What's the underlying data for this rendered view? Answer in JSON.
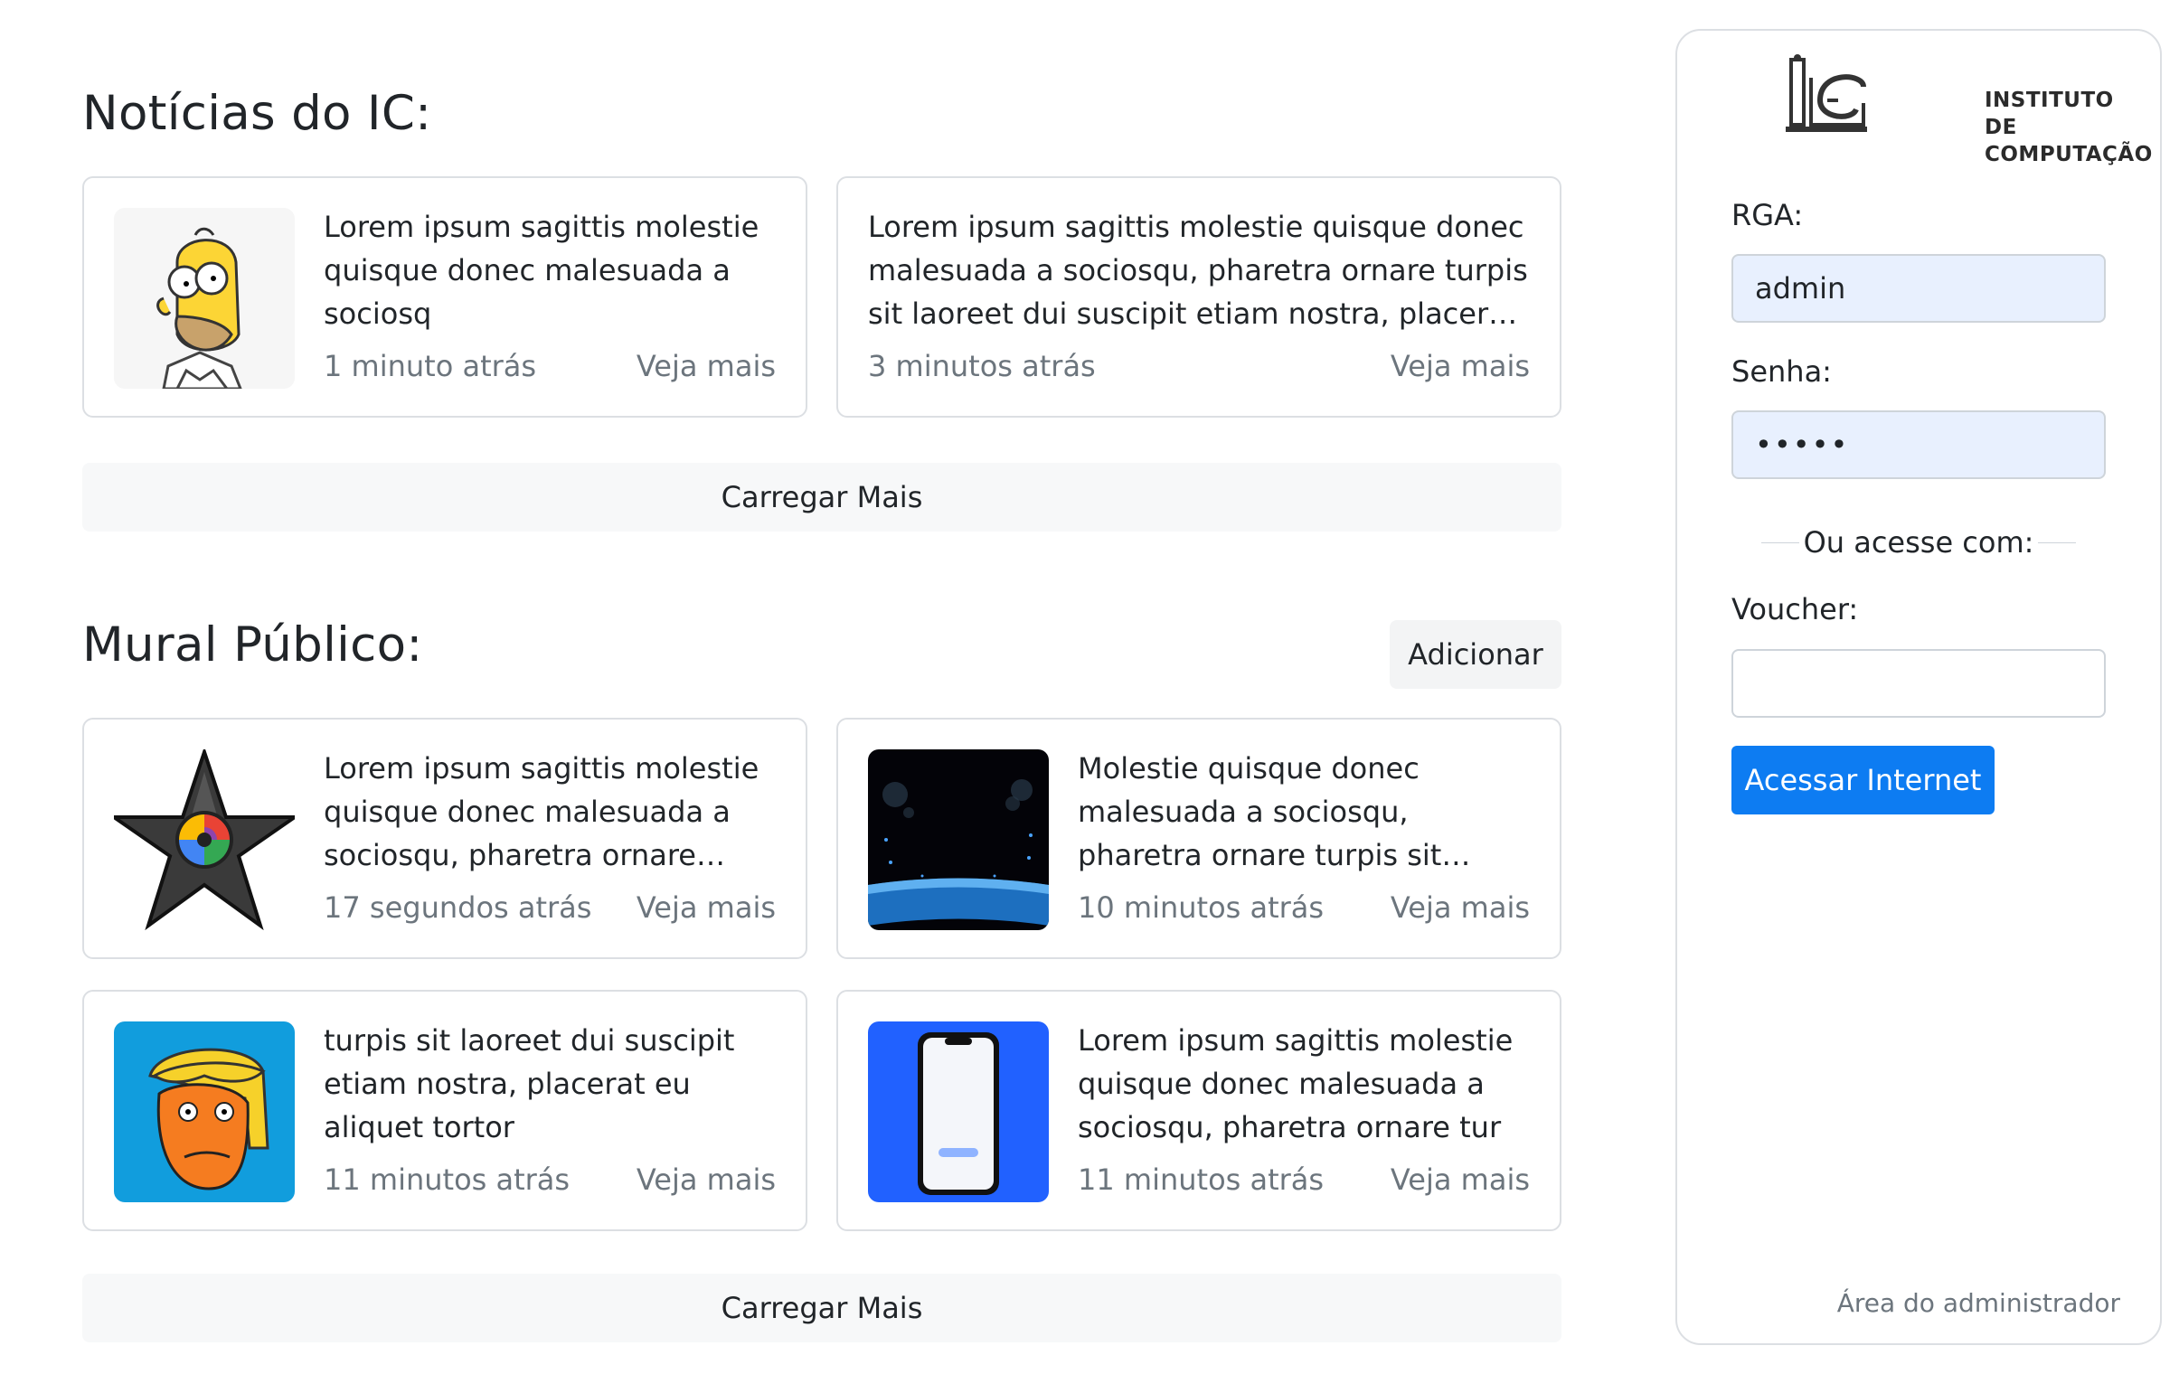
{
  "news": {
    "title": "Notícias do IC:",
    "items": [
      {
        "text": "Lorem ipsum sagittis molestie quisque donec malesuada a sociosq",
        "time": "1 minuto atrás",
        "more": "Veja mais",
        "image": "homer-simpson-avatar"
      },
      {
        "text": "Lorem ipsum sagittis molestie quisque donec malesuada a sociosqu, pharetra ornare turpis sit laoreet dui suscipit etiam nostra, placerat eu…",
        "time": "3 minutos atrás",
        "more": "Veja mais"
      }
    ],
    "load_more": "Carregar Mais"
  },
  "mural": {
    "title": "Mural Público:",
    "add_label": "Adicionar",
    "items": [
      {
        "text": "Lorem ipsum sagittis molestie quisque donec malesuada a sociosqu, pharetra ornare turpis…",
        "time": "17 segundos atrás",
        "more": "Veja mais",
        "image": "barnstar-star"
      },
      {
        "text": "Molestie quisque donec malesuada a sociosqu, pharetra ornare turpis sit laoreet dui…",
        "time": "10 minutos atrás",
        "more": "Veja mais",
        "image": "dark-stage-banner"
      },
      {
        "text": "turpis sit laoreet dui suscipit etiam nostra, placerat eu aliquet tortor",
        "time": "11 minutos atrás",
        "more": "Veja mais",
        "image": "cartoon-face"
      },
      {
        "text": "Lorem ipsum sagittis molestie quisque donec malesuada a sociosqu, pharetra ornare tur",
        "time": "11 minutos atrás",
        "more": "Veja mais",
        "image": "phone-mockup"
      }
    ],
    "load_more": "Carregar Mais"
  },
  "login": {
    "logo_line1": "INSTITUTO DE",
    "logo_line2": "COMPUTAÇÃO",
    "rga_label": "RGA:",
    "rga_value": "admin",
    "senha_label": "Senha:",
    "senha_value": "•••••",
    "divider_text": "Ou acesse com:",
    "voucher_label": "Voucher:",
    "voucher_value": "",
    "submit_label": "Acessar Internet",
    "admin_link": "Área do administrador"
  },
  "colors": {
    "primary": "#0d7cf2",
    "input_filled_bg": "#e8f0fe",
    "muted_text": "#6c757d"
  }
}
